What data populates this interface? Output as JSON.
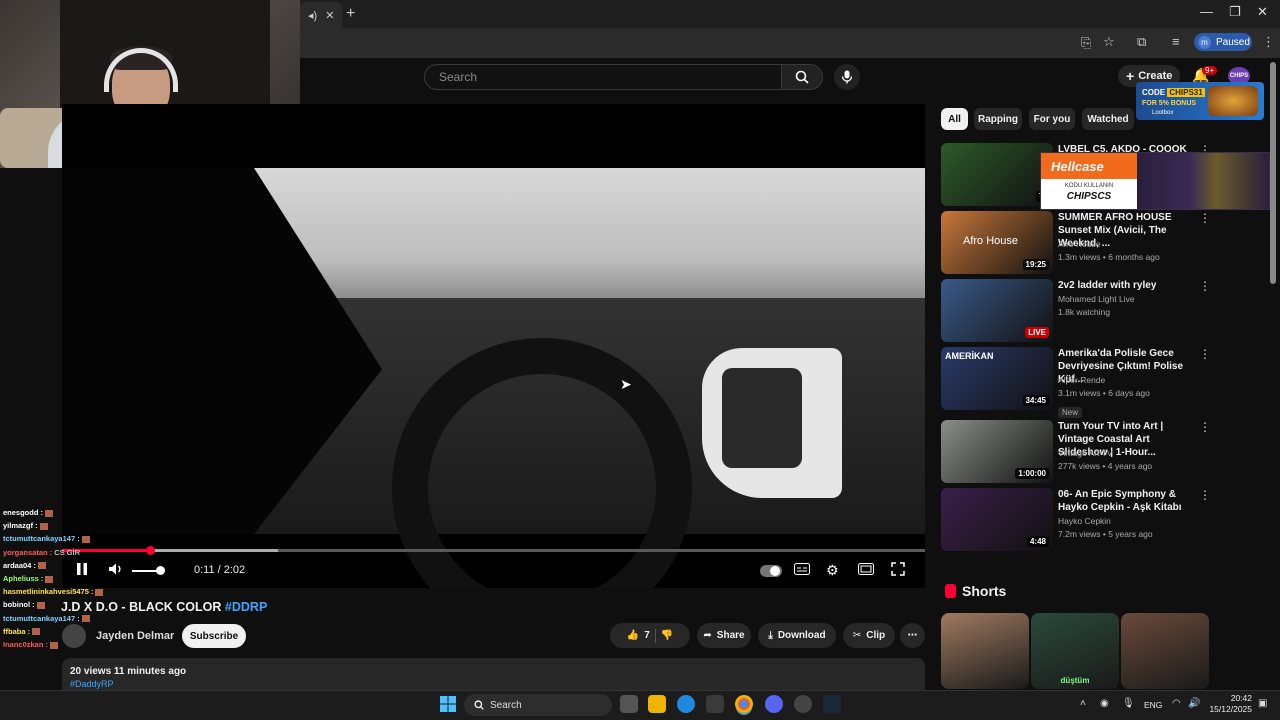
{
  "browser": {
    "new_tab": "+",
    "profile_label": "Paused",
    "profile_initial": "m",
    "tab_close": "✕",
    "tab_audio": "◂)"
  },
  "header": {
    "search_placeholder": "Search",
    "create_label": "Create",
    "notif_count": "9+",
    "chips_logo": "CHIPS"
  },
  "promo": {
    "code_prefix": "CODE",
    "code": "CHIPS31",
    "bonus": "FOR 5% BONUS",
    "brand": "Lootbox"
  },
  "hellcase": {
    "logo": "Hellcase",
    "kodu": "KODU KULLANIN",
    "code": "CHIPSCS"
  },
  "player": {
    "time": "0:11 / 2:02",
    "progress_fraction": 0.102,
    "buffer_fraction": 0.25,
    "volume_fraction": 0.8
  },
  "video": {
    "title": "J.D X D.O - BLACK COLOR",
    "hashtag": "#DDRP",
    "channel": "Jayden Delmar",
    "subscribe": "Subscribe",
    "likes": "7",
    "share": "Share",
    "download": "Download",
    "clip": "Clip",
    "stats": "20 views  11 minutes ago",
    "desc_tag": "#DaddyRP"
  },
  "chat": [
    {
      "user": "enesgodd :",
      "msg": "",
      "color": "#ffffff"
    },
    {
      "user": "yilmazgf :",
      "msg": "",
      "color": "#ffffff"
    },
    {
      "user": "tctumuttcankaya147 :",
      "msg": "",
      "color": "#7fd3ff"
    },
    {
      "user": "yorgansatan :",
      "msg": "CS GİR",
      "color": "#ff5a5a"
    },
    {
      "user": "ardaa04 :",
      "msg": "",
      "color": "#ffffff"
    },
    {
      "user": "Apheliuss :",
      "msg": "",
      "color": "#9fff6a"
    },
    {
      "user": "hasmetlininkahvesi5475 :",
      "msg": "",
      "color": "#ffe14d"
    },
    {
      "user": "bobinol :",
      "msg": "",
      "color": "#ffffff"
    },
    {
      "user": "tctumuttcankaya147 :",
      "msg": "",
      "color": "#7fd3ff"
    },
    {
      "user": "ffbaba :",
      "msg": "",
      "color": "#ffe14d"
    },
    {
      "user": "Inanc0zkan :",
      "msg": "",
      "color": "#ff5a5a"
    }
  ],
  "chips": [
    "All",
    "Rapping",
    "For you",
    "Watched"
  ],
  "recommendations": [
    {
      "title": "LVBEL C5, AKDO - COOOK",
      "channel": "",
      "meta": "",
      "duration": "7:",
      "thumb": "#2d5a2a"
    },
    {
      "title": "SUMMER AFRO HOUSE Sunset Mix (Avicii, The Weeknd, ...",
      "channel": "Afro House",
      "meta": "1.3m views • 6 months ago",
      "duration": "19:25",
      "thumb": "#c9773a",
      "thumb_text": "Afro House"
    },
    {
      "title": "2v2 ladder with ryley",
      "channel": "Mohamed Light Live",
      "meta": "1.8k watching",
      "duration": "LIVE",
      "thumb": "#3a5a8a"
    },
    {
      "title": "Amerika'da Polisle Gece Devriyesine Çıktım! Polise Küf...",
      "channel": "Alper Rende",
      "meta": "3.1m views • 6 days ago",
      "duration": "34:45",
      "thumb": "#2a3a6a",
      "badge": "New",
      "thumb_text": "AMERİKAN"
    },
    {
      "title": "Turn Your TV into Art | Vintage Coastal Art Slideshow | 1-Hour...",
      "channel": "Vintage Art TV",
      "meta": "277k views • 4 years ago",
      "duration": "1:00:00",
      "thumb": "#8a8f88"
    },
    {
      "title": "06- An Epic Symphony & Hayko Cepkin - Aşk Kitabı",
      "channel": "Hayko Cepkin",
      "meta": "7.2m views • 5 years ago",
      "duration": "4:48",
      "thumb": "#3a1f4a"
    }
  ],
  "shorts": {
    "title": "Shorts",
    "items": [
      {
        "thumb": "#a07a60"
      },
      {
        "thumb": "#2a4a3a",
        "caption": "düştüm"
      },
      {
        "thumb": "#6a4a3a"
      }
    ]
  },
  "taskbar": {
    "search": "Search",
    "lang": "ENG",
    "time": "20:42",
    "date": "15/12/2025"
  }
}
